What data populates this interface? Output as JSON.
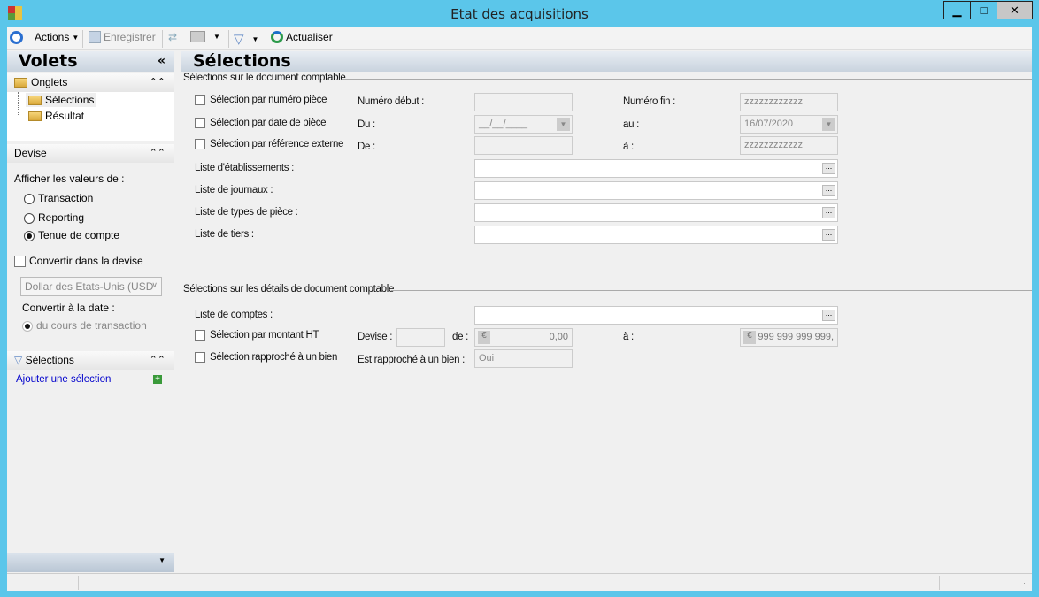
{
  "window": {
    "title": "Etat des acquisitions",
    "minimize": "▁",
    "maximize": "□",
    "close": "✕"
  },
  "toolbar": {
    "actions": "Actions",
    "save": "Enregistrer",
    "refresh": "Actualiser"
  },
  "left": {
    "title": "Volets",
    "collapse": "«",
    "tabs_group": {
      "title": "Onglets",
      "items": [
        "Sélections",
        "Résultat"
      ]
    },
    "currency_group": {
      "title": "Devise",
      "show_values_label": "Afficher les valeurs de :",
      "options": [
        "Transaction",
        "Reporting",
        "Tenue de compte"
      ],
      "selected": "Tenue de compte",
      "convert_label": "Convertir dans la devise",
      "currency_value": "Dollar des Etats-Unis (USD",
      "convert_date_label": "Convertir à la date :",
      "rate_option": "du cours de transaction"
    },
    "selections_group": {
      "title": "Sélections",
      "add_link": "Ajouter une sélection"
    }
  },
  "main": {
    "title": "Sélections",
    "section1": {
      "title": "Sélections sur le document comptable",
      "rows": [
        {
          "check": "Sélection par numéro pièce",
          "l1": "Numéro début :",
          "v1": "",
          "l2": "Numéro fin :",
          "v2": "zzzzzzzzzzzz"
        },
        {
          "check": "Sélection par date de pièce",
          "l1": "Du :",
          "v1": "__/__/____",
          "l2": "au :",
          "v2": "16/07/2020"
        },
        {
          "check": "Sélection par référence externe",
          "l1": "De :",
          "v1": "",
          "l2": "à :",
          "v2": "zzzzzzzzzzzz"
        }
      ],
      "lists": [
        "Liste d'établissements :",
        "Liste de journaux :",
        "Liste de types de pièce :",
        "Liste de tiers :"
      ]
    },
    "section2": {
      "title": "Sélections sur les détails de document comptable",
      "accounts": "Liste de comptes :",
      "amount_check": "Sélection par montant HT",
      "currency_label": "Devise :",
      "from_label": "de :",
      "from_value": "0,00",
      "to_label": "à :",
      "to_value": "999 999 999 999,",
      "asset_check": "Sélection rapproché à un bien",
      "asset_label": "Est rapproché à un bien :",
      "asset_value": "Oui"
    }
  },
  "colors": {
    "frame": "#5bc6ea",
    "link": "#0000cc"
  }
}
